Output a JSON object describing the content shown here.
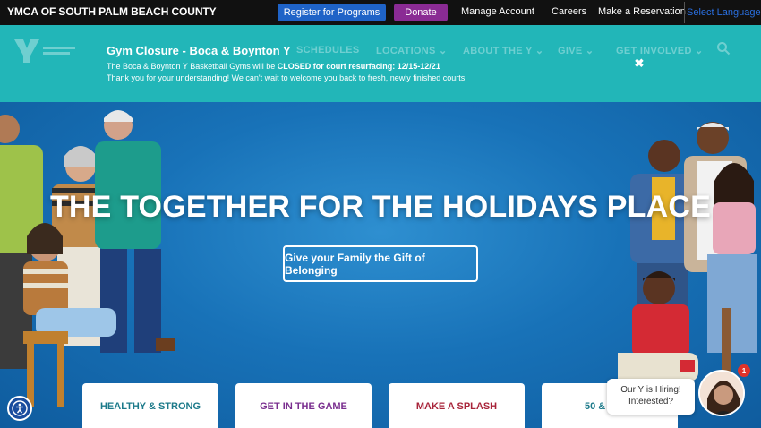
{
  "topbar": {
    "org_name": "YMCA OF SOUTH PALM BEACH COUNTY",
    "register_label": "Register for Programs",
    "donate_label": "Donate",
    "links": [
      "Manage Account",
      "Careers",
      "Make a Reservation"
    ],
    "language_label": "Select Language"
  },
  "nav": {
    "items": [
      "SCHEDULES",
      "LOCATIONS ⌄",
      "ABOUT THE Y ⌄",
      "GIVE ⌄",
      "GET INVOLVED ⌄"
    ],
    "search_icon": "search-icon"
  },
  "alert": {
    "title": "Gym Closure - Boca & Boynton Y",
    "line1_prefix": "The Boca & Boynton Y Basketball Gyms will be ",
    "line1_bold": "CLOSED for court resurfacing: 12/15-12/21",
    "line2": "Thank you for your understanding! We can't wait to welcome you back to fresh, newly finished courts!",
    "close_icon": "close-icon",
    "close_glyph": "✖"
  },
  "hero": {
    "title": "THE TOGETHER FOR THE HOLIDAYS PLACE",
    "cta_label": "Give your Family the Gift of Belonging"
  },
  "cards": [
    {
      "label": "HEALTHY & STRONG",
      "color": "#1c7a8a"
    },
    {
      "label": "GET IN THE GAME",
      "color": "#7a2f8f"
    },
    {
      "label": "MAKE A SPLASH",
      "color": "#a8243a"
    },
    {
      "label": "50 & UP",
      "color": "#1c7a8a"
    }
  ],
  "chat": {
    "line1": "Our Y is Hiring!",
    "line2": "Interested?",
    "badge_count": "1"
  },
  "colors": {
    "topbar_bg": "#111111",
    "register_bg": "#1f63c7",
    "donate_bg": "#8a2b94",
    "alert_bg": "#22b6b8",
    "hero_bg": "#1872b8"
  }
}
